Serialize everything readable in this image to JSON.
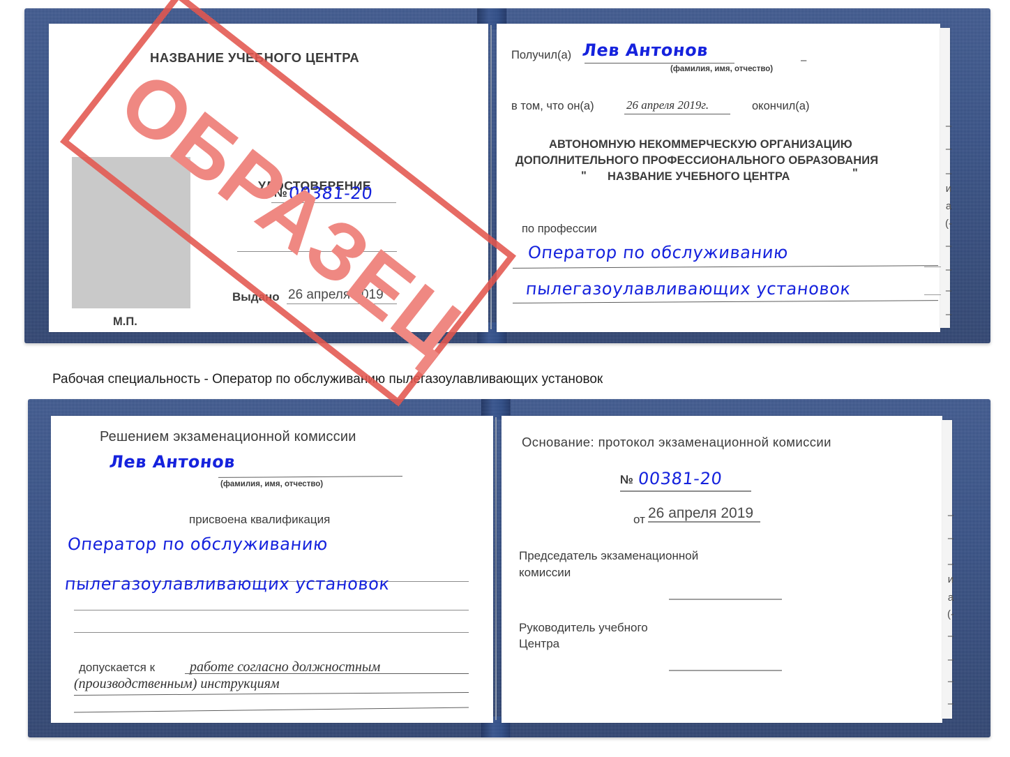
{
  "caption": {
    "text": "Рабочая специальность - Оператор по обслуживанию пылегазоулавливающих установок"
  },
  "watermark": {
    "label": "ОБРАЗЕЦ",
    "border_color": "#e2564f",
    "text_color": "#ef8882"
  },
  "certificate_top": {
    "left_page": {
      "center_name": "НАЗВАНИЕ УЧЕБНОГО ЦЕНТРА",
      "doc_title": "УДОСТОВЕРЕНИЕ",
      "number_label": "№",
      "number_value": "00381-20",
      "issued_label": "Выдано",
      "issued_value": "26 апреля 2019",
      "seal_label": "М.П."
    },
    "right_page": {
      "received_label": "Получил(а)",
      "received_value": "Лев Антонов",
      "fio_hint": "(фамилия, имя, отчество)",
      "that_he_label": "в том, что он(а)",
      "completion_date": "26 апреля 2019г.",
      "finished_label": "окончил(а)",
      "org_line1": "АВТОНОМНУЮ НЕКОММЕРЧЕСКУЮ ОРГАНИЗАЦИЮ",
      "org_line2": "ДОПОЛНИТЕЛЬНОГО ПРОФЕССИОНАЛЬНОГО ОБРАЗОВАНИЯ",
      "org_quote_open": "\"",
      "org_name": "НАЗВАНИЕ УЧЕБНОГО ЦЕНТРА",
      "org_quote_close": "\"",
      "profession_label": "по профессии",
      "profession_line1": "Оператор по обслуживанию",
      "profession_line2": "пылегазоулавливающих установок"
    }
  },
  "certificate_bottom": {
    "left_page": {
      "commission_line": "Решением экзаменационной комиссии",
      "student_name": "Лев Антонов",
      "fio_hint": "(фамилия, имя, отчество)",
      "qualification_label": "присвоена квалификация",
      "qualification_line1": "Оператор по обслуживанию",
      "qualification_line2": "пылегазоулавливающих установок",
      "admitted_label": "допускается к",
      "admitted_value_line1": "работе согласно должностным",
      "admitted_value_line2": "(производственным) инструкциям"
    },
    "right_page": {
      "basis_label": "Основание: протокол экзаменационной комиссии",
      "number_label": "№",
      "number_value": "00381-20",
      "date_label": "от",
      "date_value": "26 апреля 2019",
      "chairman_line1": "Председатель экзаменационной",
      "chairman_line2": "комиссии",
      "head_line1": "Руководитель учебного",
      "head_line2": "Центра"
    }
  },
  "edge_fragments_top": [
    "–",
    "–",
    "–",
    "и",
    "а",
    "(-",
    "–",
    "–",
    "–",
    "–"
  ],
  "edge_fragments_bottom": [
    "–",
    "–",
    "–",
    "и",
    "а",
    "(-",
    "–",
    "–",
    "–",
    "–"
  ]
}
